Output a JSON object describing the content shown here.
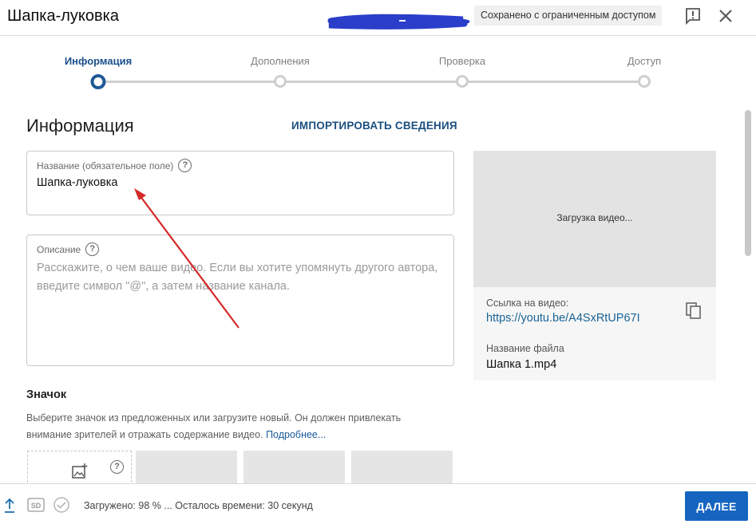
{
  "header": {
    "title": "Шапка-луковка",
    "status": "Сохранено с ограниченным доступом"
  },
  "stepper": {
    "steps": [
      {
        "label": "Информация",
        "active": true
      },
      {
        "label": "Дополнения",
        "active": false
      },
      {
        "label": "Проверка",
        "active": false
      },
      {
        "label": "Доступ",
        "active": false
      }
    ]
  },
  "details": {
    "heading": "Информация",
    "import_label": "ИМПОРТИРОВАТЬ СВЕДЕНИЯ",
    "title_field": {
      "label": "Название (обязательное поле)",
      "value": "Шапка-луковка"
    },
    "description_field": {
      "label": "Описание",
      "placeholder": "Расскажите, о чем ваше видео. Если вы хотите упомянуть другого автора, введите символ \"@\", а затем название канала."
    }
  },
  "preview": {
    "loading": "Загрузка видео...",
    "link_label": "Ссылка на видео:",
    "link": "https://youtu.be/A4SxRtUP67I",
    "file_label": "Название файла",
    "file_name": "Шапка 1.mp4"
  },
  "thumbnail": {
    "heading": "Значок",
    "description": "Выберите значок из предложенных или загрузите новый. Он должен привлекать внимание зрителей и отражать содержание видео.",
    "more_link": "Подробнее..."
  },
  "footer": {
    "status": "Загружено: 98 % ... Осталось времени: 30 секунд",
    "next_label": "ДАЛЕЕ",
    "quality_badge": "SD"
  },
  "colors": {
    "accent": "#1565c0",
    "annotation_arrow": "#d42a2a",
    "redaction_scribble": "#2b3ec9"
  }
}
